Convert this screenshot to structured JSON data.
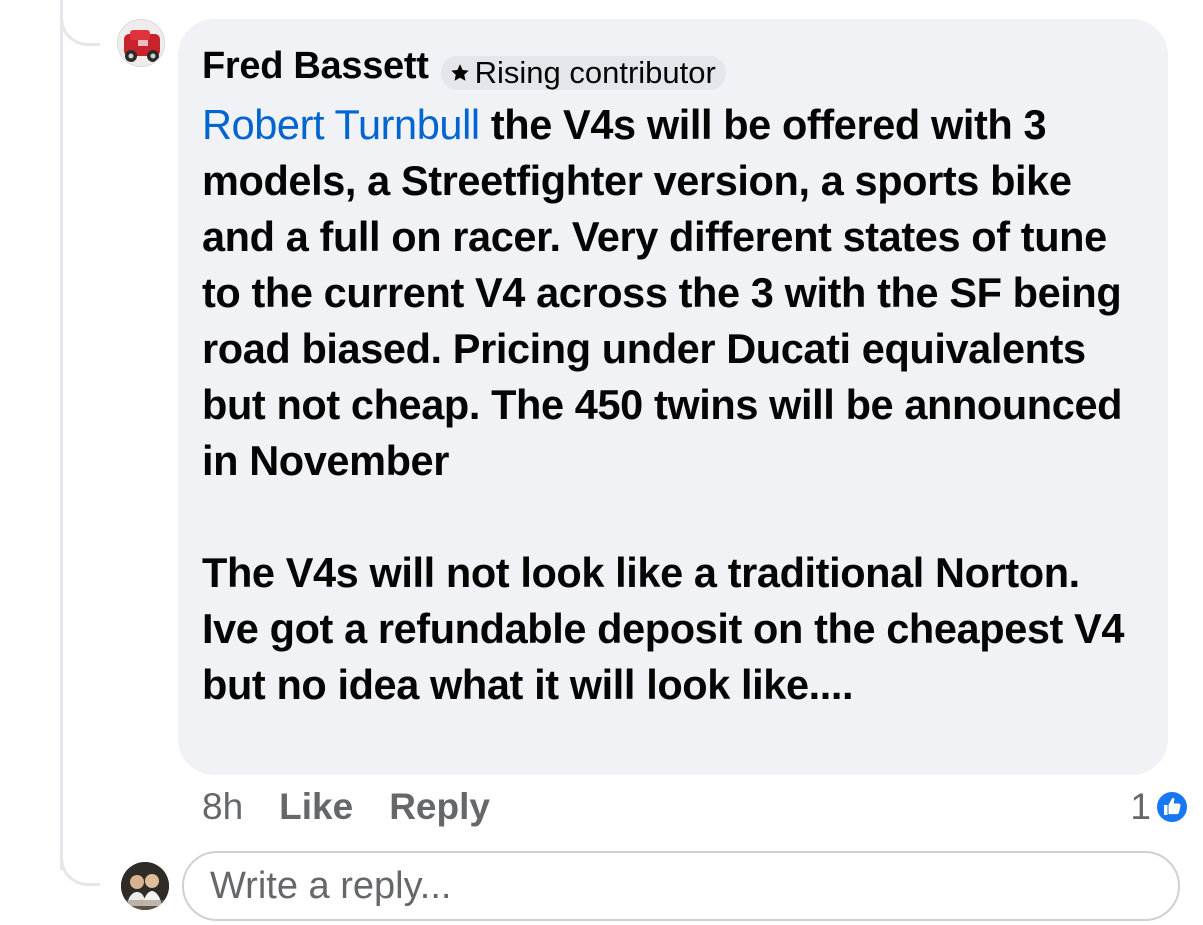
{
  "comment": {
    "author": "Fred Bassett",
    "badge": "Rising contributor",
    "mention": "Robert Turnbull",
    "paragraph1": " the V4s will be offered with 3 models, a Streetfighter version, a sports bike and a full on racer.  Very different states of tune to the current V4 across the 3 with the SF being road biased.   Pricing under Ducati equivalents but not cheap.   The 450 twins will be announced in November",
    "paragraph2": "The V4s will not look like a traditional Norton.    Ive got a refundable deposit on the cheapest V4 but no idea what it will look like...."
  },
  "actions": {
    "timestamp": "8h",
    "like": "Like",
    "reply": "Reply"
  },
  "reactions": {
    "count": "1",
    "icon": "thumbs-up-icon",
    "color": "#1877f2"
  },
  "reply_box": {
    "placeholder": "Write a reply..."
  },
  "colors": {
    "bubble": "#f0f2f5",
    "mention": "#0064d1",
    "secondary_text": "#65676b"
  }
}
